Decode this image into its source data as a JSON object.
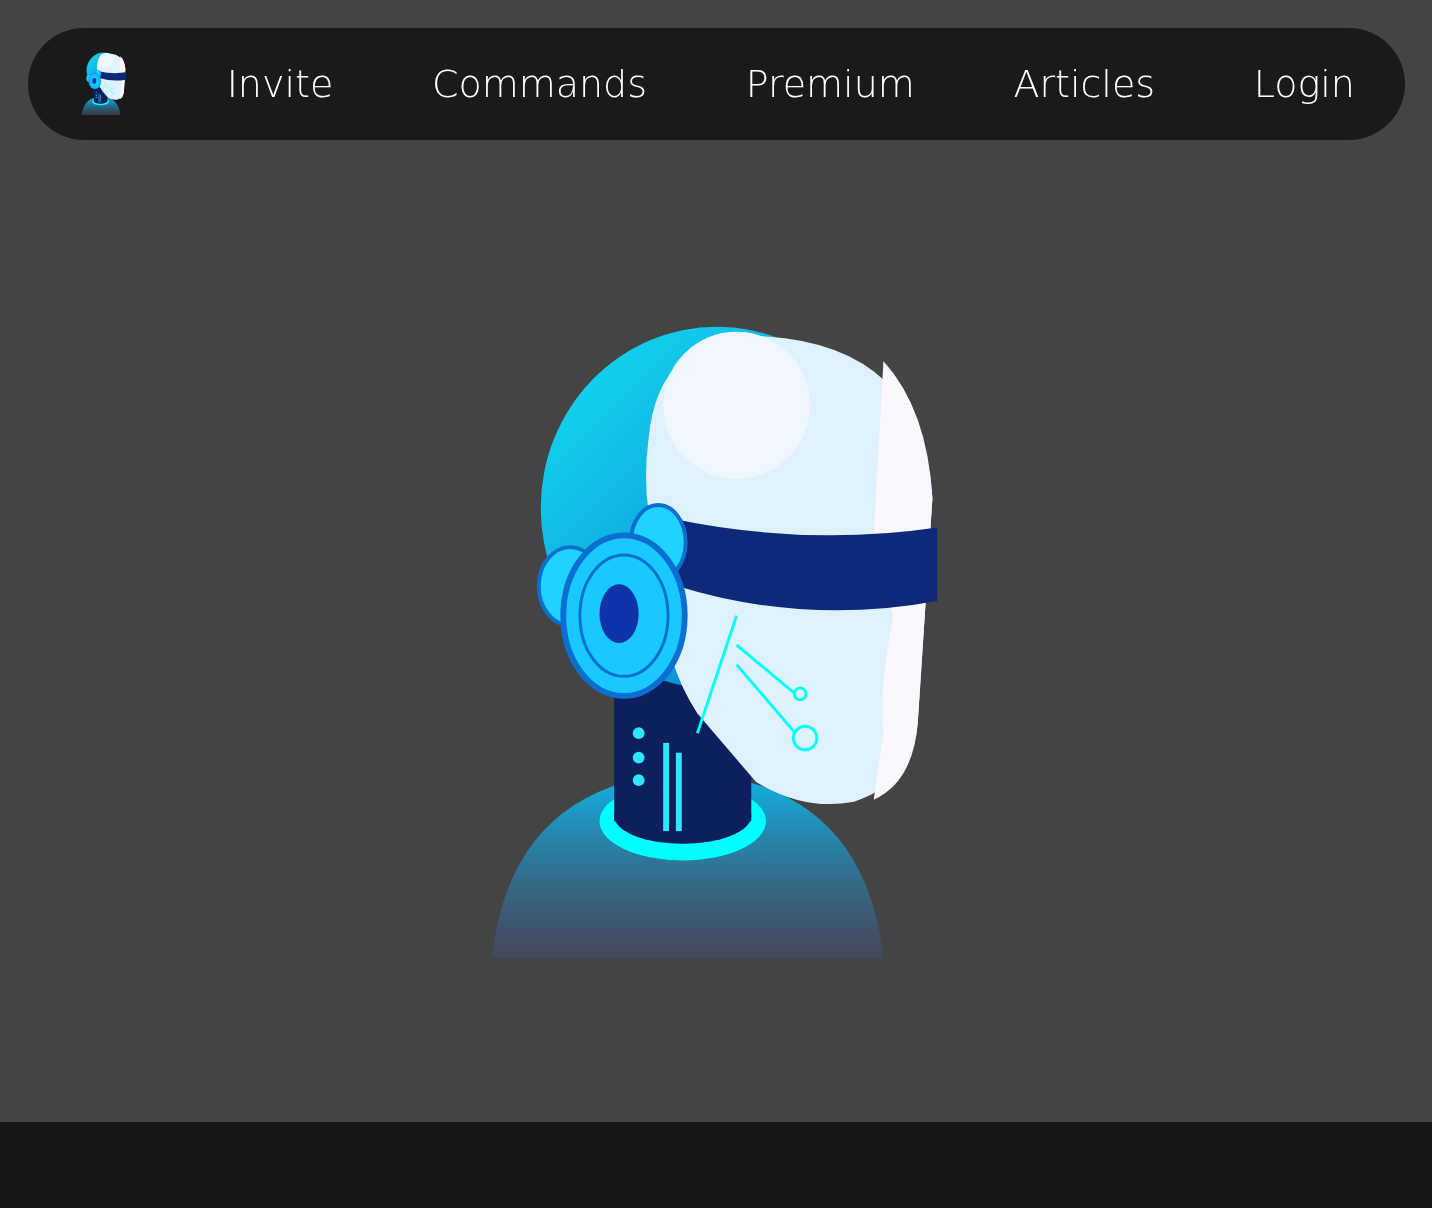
{
  "nav": {
    "links": [
      {
        "label": "Invite"
      },
      {
        "label": "Commands"
      },
      {
        "label": "Premium"
      },
      {
        "label": "Articles"
      },
      {
        "label": "Login"
      }
    ]
  }
}
